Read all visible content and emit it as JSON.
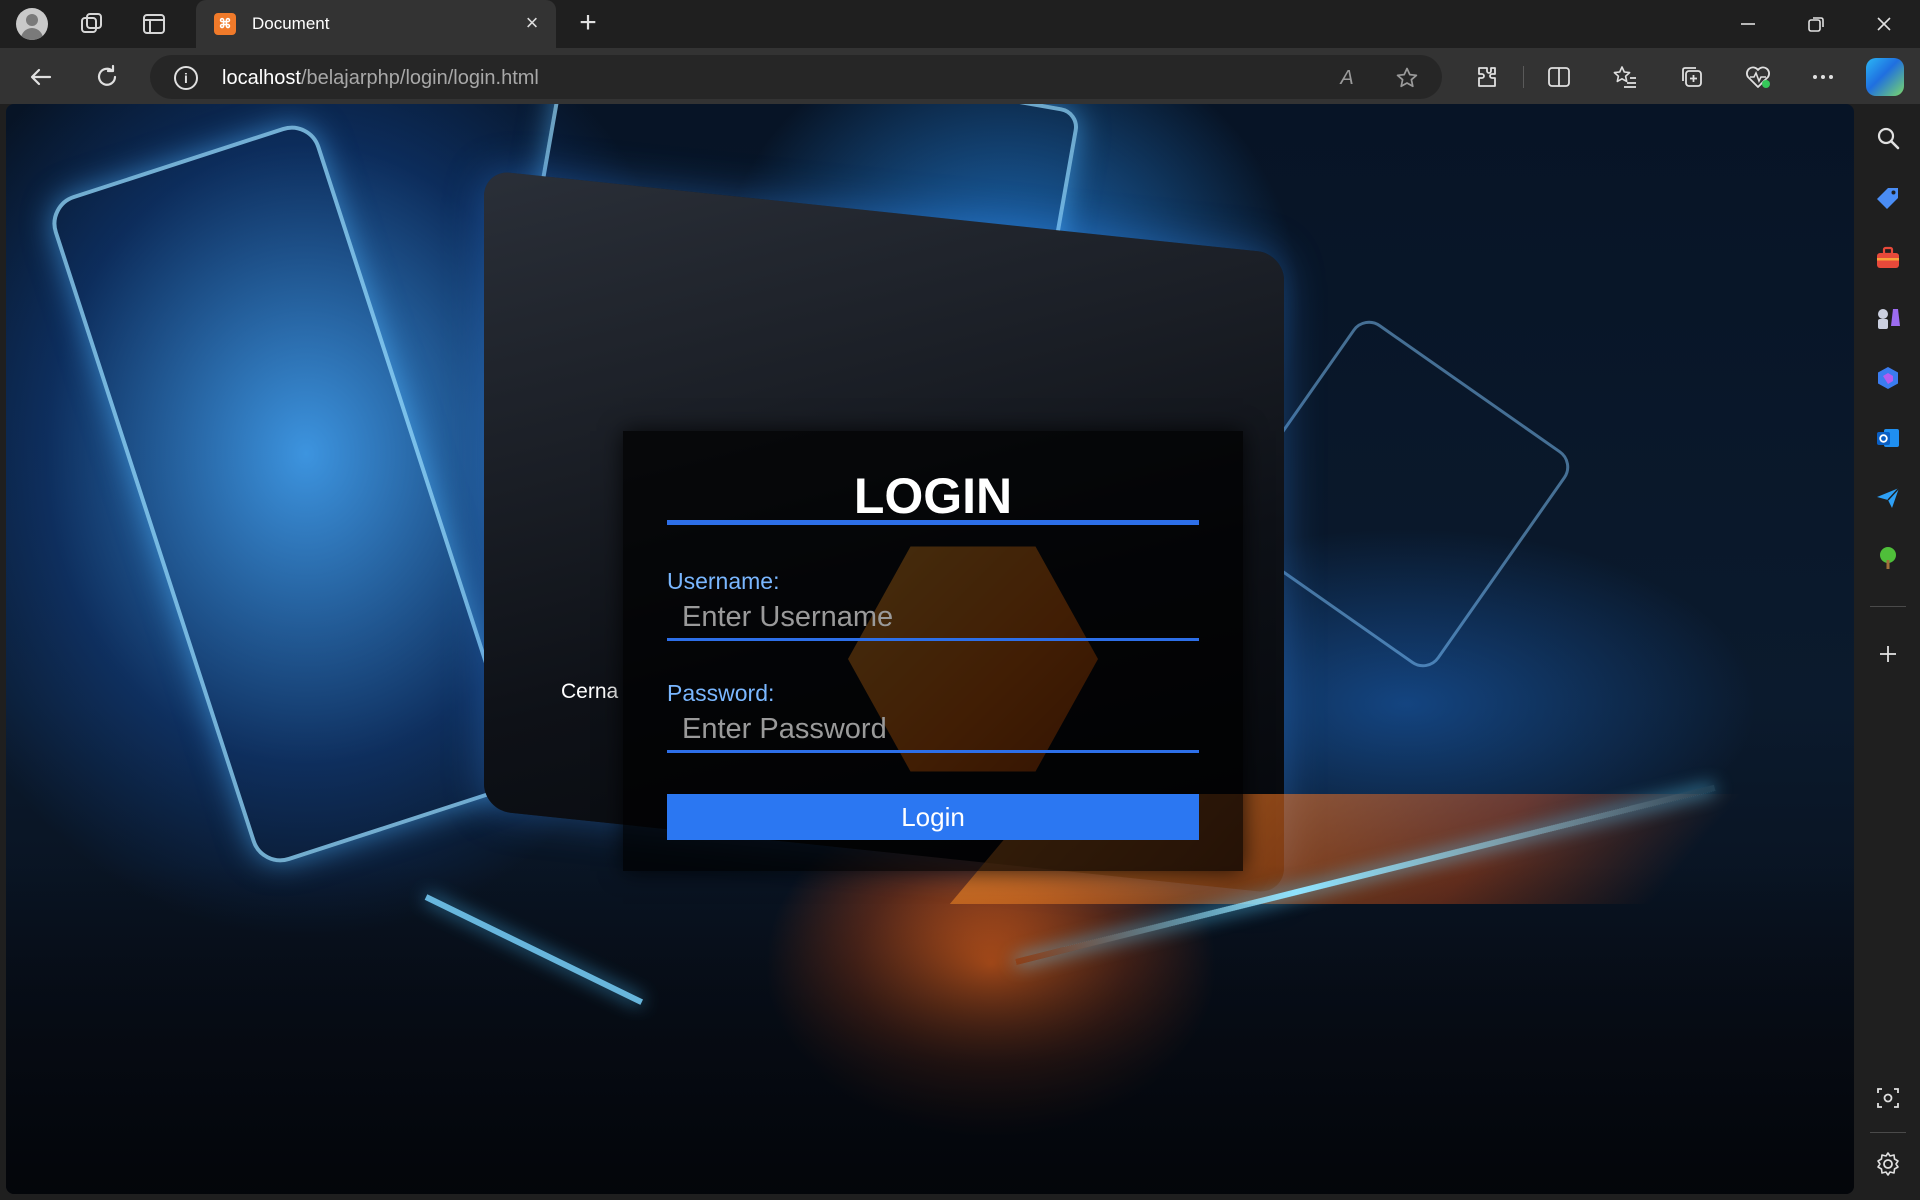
{
  "browser": {
    "tab_title": "Document",
    "tab_favicon_letter": "⌘",
    "url_host": "localhost",
    "url_path": "/belajarphp/login/login.html",
    "read_aloud_label": "A",
    "accent_color": "#2d6fe8"
  },
  "background": {
    "overlay_text": "Cerna"
  },
  "login": {
    "title": "LOGIN",
    "username_label": "Username:",
    "username_placeholder": "Enter Username",
    "password_label": "Password:",
    "password_placeholder": "Enter Password",
    "button_label": "Login"
  },
  "sidebar_icons": [
    "search-icon",
    "shopping-tag-icon",
    "tools-icon",
    "games-icon",
    "copilot-icon",
    "outlook-icon",
    "send-icon",
    "tree-icon",
    "add-icon",
    "screenshot-icon",
    "settings-icon"
  ]
}
